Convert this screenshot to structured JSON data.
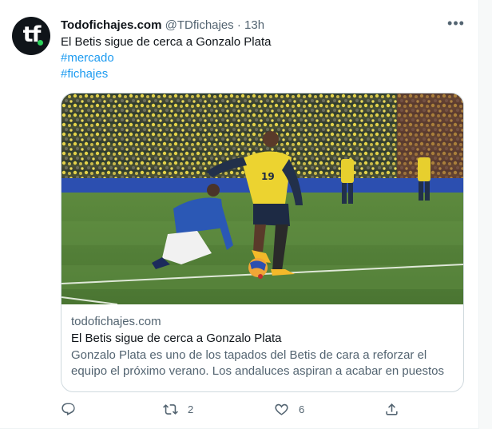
{
  "tweet": {
    "display_name": "Todofichajes.com",
    "handle": "@TDfichajes",
    "separator": "·",
    "time": "13h",
    "more_label": "•••",
    "text": "El Betis sigue de cerca a Gonzalo Plata",
    "hashtags": [
      "#mercado",
      "#fichajes"
    ]
  },
  "avatar": {
    "text": "tf",
    "dot_color": "#2bd45b"
  },
  "card": {
    "domain": "todofichajes.com",
    "title": "El Betis sigue de cerca a Gonzalo Plata",
    "description": "Gonzalo Plata es uno de los tapados del Betis de cara a reforzar el equipo el próximo verano. Los andaluces aspiran a acabar en puestos ...",
    "photo_jersey_number": "19"
  },
  "actions": {
    "reply": {
      "icon": "reply-icon",
      "count": ""
    },
    "retweet": {
      "icon": "retweet-icon",
      "count": "2"
    },
    "like": {
      "icon": "heart-icon",
      "count": "6"
    },
    "share": {
      "icon": "share-icon",
      "count": ""
    }
  },
  "colors": {
    "accent": "#1d9bf0",
    "secondary_text": "#536471",
    "primary_text": "#0f1419",
    "border": "#cfd9de"
  }
}
